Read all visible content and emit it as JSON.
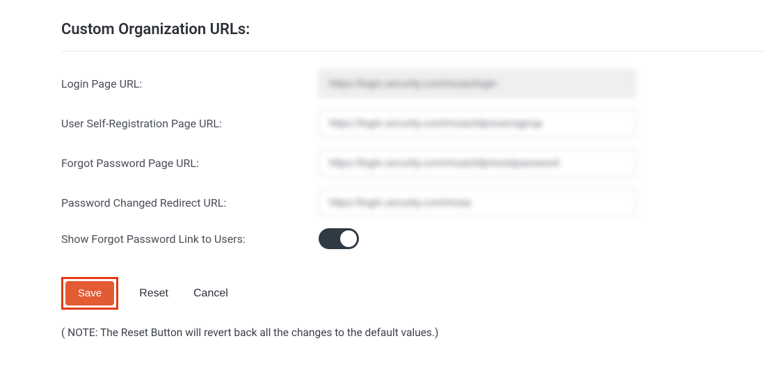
{
  "section": {
    "title": "Custom Organization URLs:"
  },
  "fields": {
    "login": {
      "label": "Login Page URL:",
      "value": "https://login.security.com/moas/login",
      "readonly": true
    },
    "signup": {
      "label": "User Self-Registration Page URL:",
      "value": "https://login.security.com/moas/idp/usersignup",
      "readonly": false
    },
    "forgot": {
      "label": "Forgot Password Page URL:",
      "value": "https://login.security.com/moas/idp/resetpassword",
      "readonly": false
    },
    "redirect": {
      "label": "Password Changed Redirect URL:",
      "value": "https://login.security.com/moas",
      "readonly": false
    },
    "showlink": {
      "label": "Show Forgot Password Link to Users:",
      "enabled": true
    }
  },
  "actions": {
    "save": "Save",
    "reset": "Reset",
    "cancel": "Cancel"
  },
  "note": "( NOTE: The Reset Button will revert back all the changes to the default values.)"
}
